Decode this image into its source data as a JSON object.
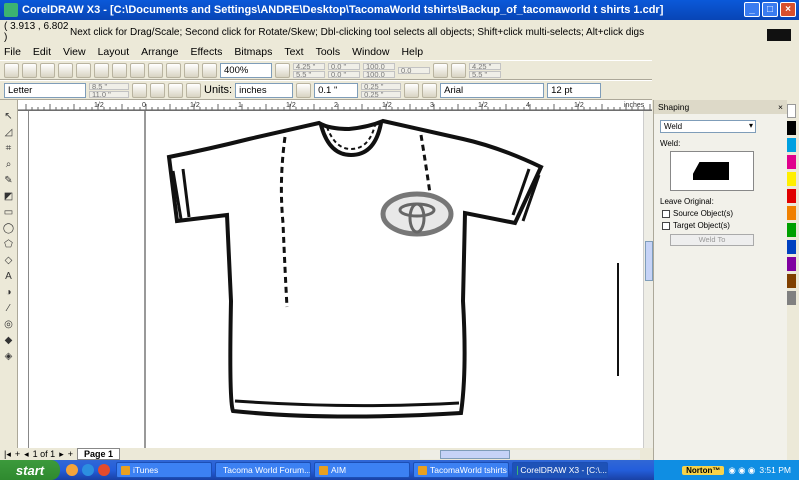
{
  "window": {
    "title": "CorelDRAW X3 - [C:\\Documents and Settings\\ANDRE\\Desktop\\TacomaWorld tshirts\\Backup_of_tacomaworld t shirts 1.cdr]",
    "minimize": "_",
    "maximize": "□",
    "close": "×"
  },
  "status": {
    "coords": "( 3.913 , 6.802 )",
    "hint": "Next click for Drag/Scale; Second click for Rotate/Skew; Dbl-clicking tool selects all objects; Shift+click multi-selects; Alt+click digs"
  },
  "menu": [
    "File",
    "Edit",
    "View",
    "Layout",
    "Arrange",
    "Effects",
    "Bitmaps",
    "Text",
    "Tools",
    "Window",
    "Help"
  ],
  "toolbar1": {
    "zoom": "400%",
    "pos_x": "4.25 \"",
    "pos_y": "5.5 \"",
    "size_w": "0.0 \"",
    "size_h": "0.0 \"",
    "scale_x": "100.0",
    "scale_y": "100.0",
    "rot": "0.0",
    "pos2_x": "4.25 \"",
    "pos2_y": "5.5 \""
  },
  "toolbar2": {
    "paper": "Letter",
    "width": "8.5 \"",
    "height": "11.0 \"",
    "units_label": "Units:",
    "units": "inches",
    "nudge": "0.1 \"",
    "dup_x": "0.25 \"",
    "dup_y": "0.25 \"",
    "font": "Arial",
    "font_size": "12 pt"
  },
  "ruler": {
    "unit": "inches",
    "ticks": [
      "1/2",
      "0",
      "1/2",
      "1",
      "1/2",
      "2",
      "1/2",
      "3",
      "1/2",
      "4",
      "1/2"
    ]
  },
  "bottom": {
    "page_count": "1 of 1",
    "page_tab": "Page 1"
  },
  "docker": {
    "title": "Shaping",
    "mode": "Weld",
    "weld_label": "Weld:",
    "leave_original": "Leave Original:",
    "source": "Source Object(s)",
    "target": "Target Object(s)",
    "apply": "Weld To"
  },
  "taskbar": {
    "start": "start",
    "tasks": [
      "iTunes",
      "Tacoma World Forum...",
      "AIM",
      "TacomaWorld tshirts",
      "CorelDRAW X3 - [C:\\..."
    ],
    "norton": "Norton™",
    "clock": "3:51 PM"
  },
  "colors": {
    "title_bar": "#0a59d9",
    "taskbar": "#245edb",
    "start": "#3c9a3c"
  }
}
